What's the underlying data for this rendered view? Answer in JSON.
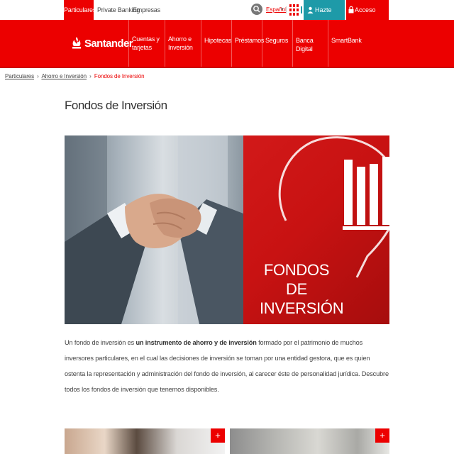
{
  "topbar": {
    "segments": [
      "Particulares",
      "Private Banking",
      "-",
      "Empresas"
    ],
    "language": "Español",
    "language_arrow": "▾",
    "hazte_cliente": "Hazte cliente",
    "acceso_clientes": "Acceso clientes"
  },
  "nav": {
    "logo_text": "Santander",
    "items": [
      {
        "line1": "Cuentas y",
        "line2": "tarjetas"
      },
      {
        "line1": "Ahorro e",
        "line2": "Inversión"
      },
      {
        "line1": "Hipotecas",
        "line2": ""
      },
      {
        "line1": "Préstamos",
        "line2": ""
      },
      {
        "line1": "Seguros",
        "line2": ""
      },
      {
        "line1": "Banca Digital",
        "line2": ""
      },
      {
        "line1": "SmartBank",
        "line2": ""
      }
    ]
  },
  "breadcrumb": {
    "items": [
      "Particulares",
      "Ahorro e Inversión"
    ],
    "separator": "›",
    "current": "Fondos de Inversión"
  },
  "page": {
    "title": "Fondos de Inversión",
    "hero_caption_line1": "FONDOS DE",
    "hero_caption_line2": "INVERSIÓN",
    "intro_part1": "Un fondo de inversión es ",
    "intro_bold": "un instrumento de ahorro y de inversión",
    "intro_part2": " formado por el patrimonio de muchos inversores particulares, en el cual las decisiones de inversión se toman por una entidad gestora, que es quien ostenta la representación y administración del fondo de inversión, al carecer éste de personalidad jurídica. Descubre todos los fondos de inversión que tenemos disponibles."
  },
  "cards": {
    "plus": "+"
  },
  "colors": {
    "brand_red": "#ec0000",
    "teal": "#1e9aa8"
  },
  "icons": [
    "search-icon",
    "apps-grid-icon",
    "user-icon",
    "lock-icon",
    "flame-logo-icon",
    "bar-chart-icon"
  ]
}
